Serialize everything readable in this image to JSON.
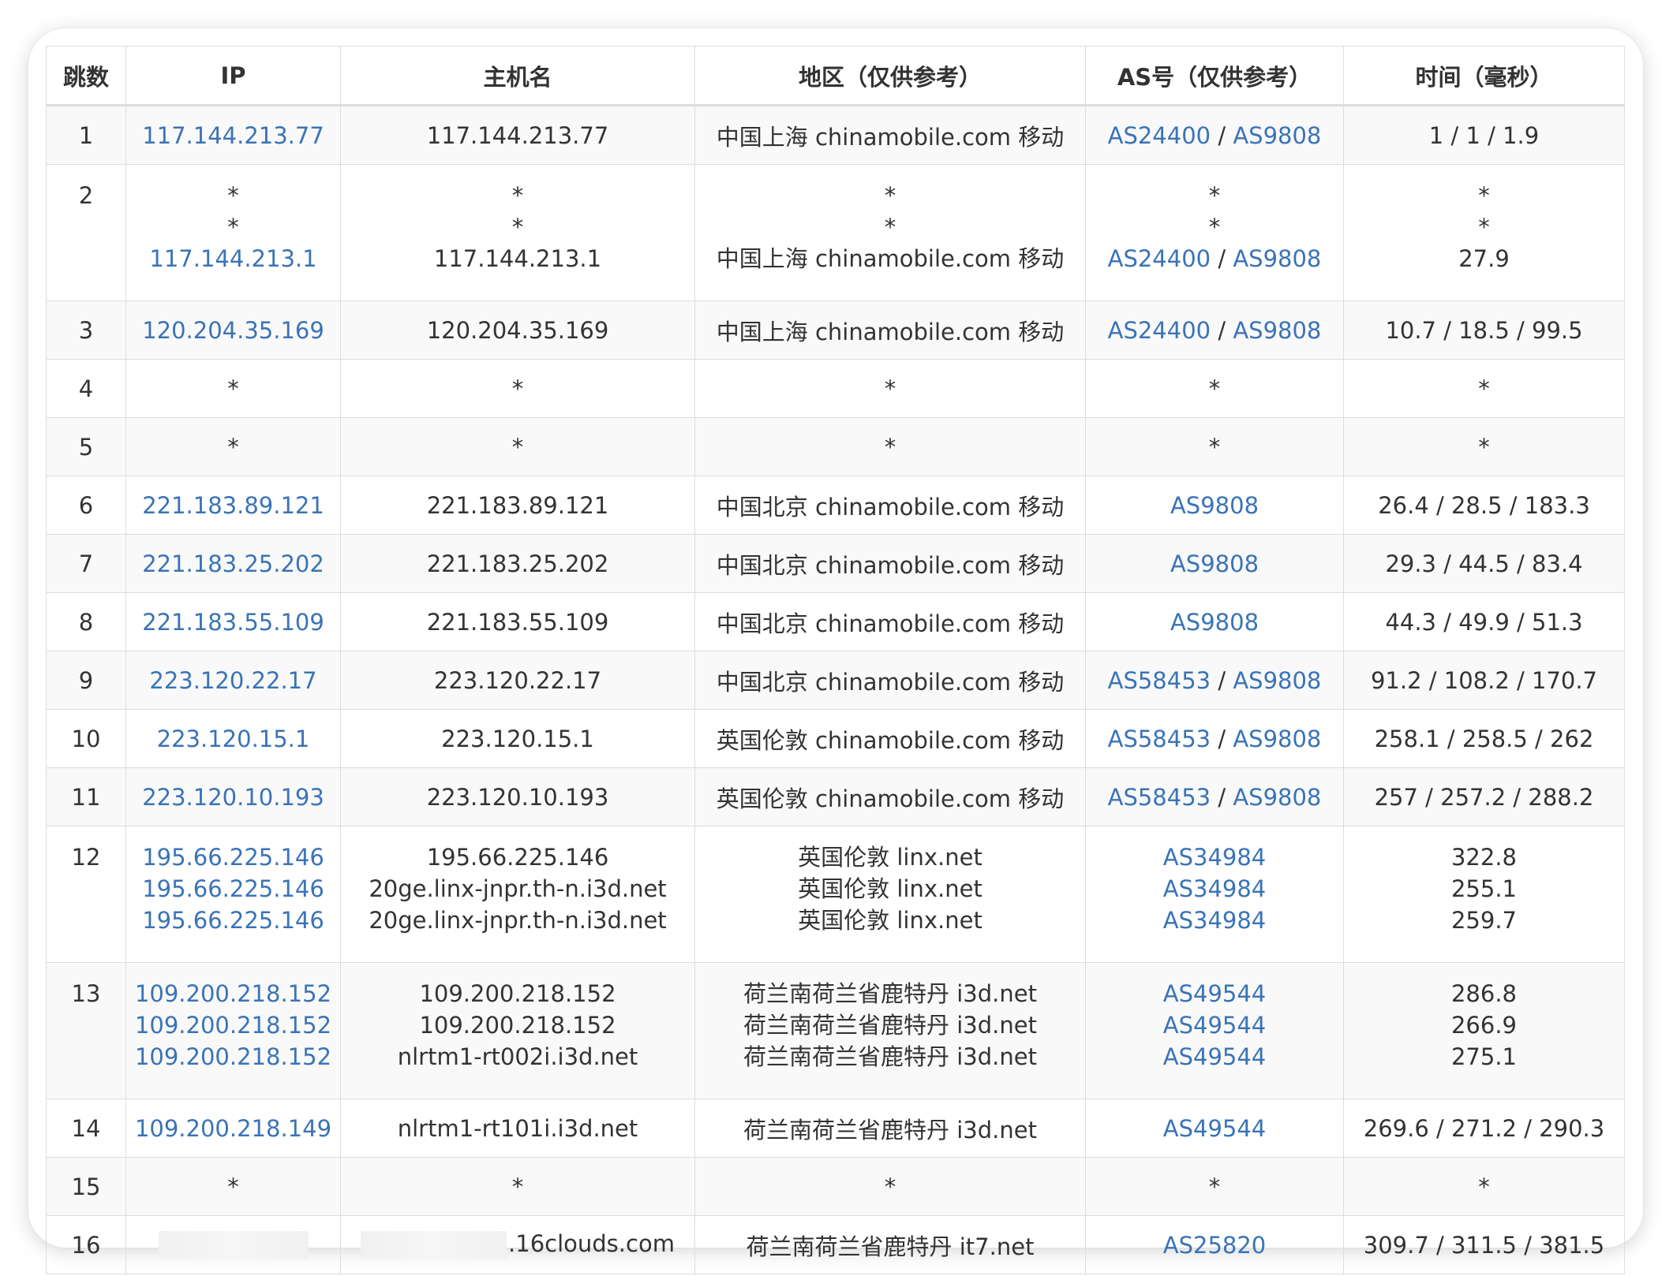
{
  "headers": [
    "跳数",
    "IP",
    "主机名",
    "地区（仅供参考）",
    "AS号（仅供参考）",
    "时间（毫秒）"
  ],
  "rows": [
    {
      "hop": "1",
      "lines": [
        {
          "ip": "117.144.213.77",
          "host": "117.144.213.77",
          "region": "中国上海 chinamobile.com 移动",
          "as": [
            "AS24400",
            "AS9808"
          ],
          "time": "1 / 1 / 1.9"
        }
      ]
    },
    {
      "hop": "2",
      "lines": [
        {
          "ip": "*",
          "host": "*",
          "region": "*",
          "as": [
            "*"
          ],
          "time": "*"
        },
        {
          "ip": "*",
          "host": "*",
          "region": "*",
          "as": [
            "*"
          ],
          "time": "*"
        },
        {
          "ip": "117.144.213.1",
          "host": "117.144.213.1",
          "region": "中国上海 chinamobile.com 移动",
          "as": [
            "AS24400",
            "AS9808"
          ],
          "time": "27.9"
        }
      ]
    },
    {
      "hop": "3",
      "lines": [
        {
          "ip": "120.204.35.169",
          "host": "120.204.35.169",
          "region": "中国上海 chinamobile.com 移动",
          "as": [
            "AS24400",
            "AS9808"
          ],
          "time": "10.7 / 18.5 / 99.5"
        }
      ]
    },
    {
      "hop": "4",
      "lines": [
        {
          "ip": "*",
          "host": "*",
          "region": "*",
          "as": [
            "*"
          ],
          "time": "*"
        }
      ]
    },
    {
      "hop": "5",
      "lines": [
        {
          "ip": "*",
          "host": "*",
          "region": "*",
          "as": [
            "*"
          ],
          "time": "*"
        }
      ]
    },
    {
      "hop": "6",
      "lines": [
        {
          "ip": "221.183.89.121",
          "host": "221.183.89.121",
          "region": "中国北京 chinamobile.com 移动",
          "as": [
            "AS9808"
          ],
          "time": "26.4 / 28.5 / 183.3"
        }
      ]
    },
    {
      "hop": "7",
      "lines": [
        {
          "ip": "221.183.25.202",
          "host": "221.183.25.202",
          "region": "中国北京 chinamobile.com 移动",
          "as": [
            "AS9808"
          ],
          "time": "29.3 / 44.5 / 83.4"
        }
      ]
    },
    {
      "hop": "8",
      "lines": [
        {
          "ip": "221.183.55.109",
          "host": "221.183.55.109",
          "region": "中国北京 chinamobile.com 移动",
          "as": [
            "AS9808"
          ],
          "time": "44.3 / 49.9 / 51.3"
        }
      ]
    },
    {
      "hop": "9",
      "lines": [
        {
          "ip": "223.120.22.17",
          "host": "223.120.22.17",
          "region": "中国北京 chinamobile.com 移动",
          "as": [
            "AS58453",
            "AS9808"
          ],
          "time": "91.2 / 108.2 / 170.7"
        }
      ]
    },
    {
      "hop": "10",
      "lines": [
        {
          "ip": "223.120.15.1",
          "host": "223.120.15.1",
          "region": "英国伦敦 chinamobile.com 移动",
          "as": [
            "AS58453",
            "AS9808"
          ],
          "time": "258.1 / 258.5 / 262"
        }
      ]
    },
    {
      "hop": "11",
      "lines": [
        {
          "ip": "223.120.10.193",
          "host": "223.120.10.193",
          "region": "英国伦敦 chinamobile.com 移动",
          "as": [
            "AS58453",
            "AS9808"
          ],
          "time": "257 / 257.2 / 288.2"
        }
      ]
    },
    {
      "hop": "12",
      "lines": [
        {
          "ip": "195.66.225.146",
          "host": "195.66.225.146",
          "region": "英国伦敦 linx.net",
          "as": [
            "AS34984"
          ],
          "time": "322.8"
        },
        {
          "ip": "195.66.225.146",
          "host": "20ge.linx-jnpr.th-n.i3d.net",
          "region": "英国伦敦 linx.net",
          "as": [
            "AS34984"
          ],
          "time": "255.1"
        },
        {
          "ip": "195.66.225.146",
          "host": "20ge.linx-jnpr.th-n.i3d.net",
          "region": "英国伦敦 linx.net",
          "as": [
            "AS34984"
          ],
          "time": "259.7"
        }
      ]
    },
    {
      "hop": "13",
      "lines": [
        {
          "ip": "109.200.218.152",
          "host": "109.200.218.152",
          "region": "荷兰南荷兰省鹿特丹 i3d.net",
          "as": [
            "AS49544"
          ],
          "time": "286.8"
        },
        {
          "ip": "109.200.218.152",
          "host": "109.200.218.152",
          "region": "荷兰南荷兰省鹿特丹 i3d.net",
          "as": [
            "AS49544"
          ],
          "time": "266.9"
        },
        {
          "ip": "109.200.218.152",
          "host": "nlrtm1-rt002i.i3d.net",
          "region": "荷兰南荷兰省鹿特丹 i3d.net",
          "as": [
            "AS49544"
          ],
          "time": "275.1"
        }
      ]
    },
    {
      "hop": "14",
      "lines": [
        {
          "ip": "109.200.218.149",
          "host": "nlrtm1-rt101i.i3d.net",
          "region": "荷兰南荷兰省鹿特丹 i3d.net",
          "as": [
            "AS49544"
          ],
          "time": "269.6 / 271.2 / 290.3"
        }
      ]
    },
    {
      "hop": "15",
      "lines": [
        {
          "ip": "*",
          "host": "*",
          "region": "*",
          "as": [
            "*"
          ],
          "time": "*"
        }
      ]
    },
    {
      "hop": "16",
      "lines": [
        {
          "ip": "",
          "ip_redacted": true,
          "host": ".16clouds.com",
          "host_redacted": true,
          "region": "荷兰南荷兰省鹿特丹 it7.net",
          "as": [
            "AS25820"
          ],
          "time": "309.7 / 311.5 / 381.5"
        }
      ]
    }
  ],
  "colors": {
    "link": "#3a73b7",
    "text": "#333333",
    "border": "#dddddd",
    "zebra": "#f9f9f9"
  }
}
